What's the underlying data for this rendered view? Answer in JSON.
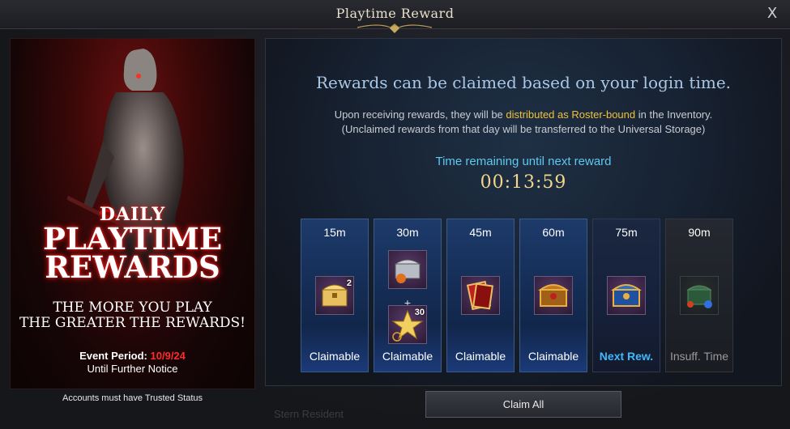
{
  "window": {
    "title": "Playtime Reward",
    "close_label": "X"
  },
  "banner": {
    "daily": "DAILY",
    "playtime": "PLAYTIME",
    "rewards": "REWARDS",
    "tagline_1": "THE MORE YOU PLAY",
    "tagline_2": "THE GREATER THE REWARDS!",
    "event_period_label": "Event Period:",
    "event_period_date": "10/9/24",
    "until": "Until Further Notice",
    "trusted_note": "Accounts must have Trusted Status"
  },
  "panel": {
    "headline": "Rewards can be claimed based on your login time.",
    "desc_pre": "Upon receiving rewards, they will be",
    "desc_highlight": "distributed as Roster-bound",
    "desc_post": "in the Inventory.",
    "desc_2": "(Unclaimed rewards from that day will be transferred to the Universal Storage)",
    "remaining_label": "Time remaining until next reward",
    "timer": "00:13:59"
  },
  "slots": [
    {
      "time": "15m",
      "status": "Claimable",
      "items": [
        {
          "icon": "golden-chest-icon",
          "qty": "2"
        }
      ]
    },
    {
      "time": "30m",
      "status": "Claimable",
      "items": [
        {
          "icon": "silver-chest-icon",
          "qty": ""
        },
        {
          "icon": "star-icon",
          "qty": "30"
        }
      ]
    },
    {
      "time": "45m",
      "status": "Claimable",
      "items": [
        {
          "icon": "card-pack-icon",
          "qty": ""
        }
      ]
    },
    {
      "time": "60m",
      "status": "Claimable",
      "items": [
        {
          "icon": "ornate-chest-icon",
          "qty": ""
        }
      ]
    },
    {
      "time": "75m",
      "status": "Next Rew.",
      "items": [
        {
          "icon": "blue-chest-icon",
          "qty": ""
        }
      ]
    },
    {
      "time": "90m",
      "status": "Insuff. Time",
      "items": [
        {
          "icon": "green-chest-icon",
          "qty": ""
        }
      ]
    }
  ],
  "actions": {
    "claim_all": "Claim All"
  },
  "background_text": "Stern Resident",
  "colors": {
    "highlight": "#f0c23a",
    "next": "#3fb8ff",
    "timer": "#f2d68a",
    "event_date": "#ff2a2a"
  }
}
